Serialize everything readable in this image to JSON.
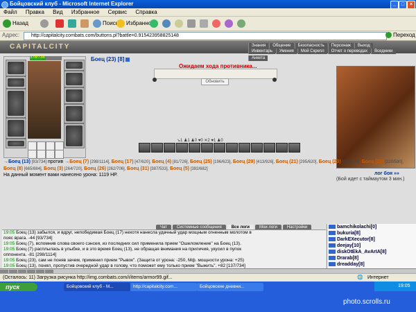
{
  "window": {
    "title": "Бойцовский клуб - Microsoft Internet Explorer",
    "controls": [
      "_",
      "□",
      "×"
    ]
  },
  "menu": [
    "Файл",
    "Правка",
    "Вид",
    "Избранное",
    "Сервис",
    "Справка"
  ],
  "toolbar": {
    "back": "Назад",
    "search": "Поиск",
    "favorites": "Избранное"
  },
  "address": {
    "label": "Адрес:",
    "url": "http://capitalcity.combats.com/buttons.pl?battle=0.915423958825148",
    "go": "Переход"
  },
  "game": {
    "logo": "CAPITALCITY",
    "nav_top": [
      "Знания",
      "Общение",
      "Безопасность",
      "Персонаж",
      "Выход"
    ],
    "nav_bottom": [
      "Инвентарь",
      "Умения",
      "Мой Скрепл",
      "Отчет о переводах",
      "Вседники",
      "Анкета"
    ],
    "player_hp": "378/734",
    "player_hp_fraction": 0.51,
    "opponent_name": "Боец (23) [8]",
    "waiting": "Ожидаем хода противника...",
    "refresh": "Обновить",
    "counters": "↘1 ♟1 ♟0 ♥0 ✕2 ♥1 ♟0",
    "team_line": [
      {
        "t": "→",
        "c": "arr"
      },
      {
        "t": "Боец (13)",
        "c": "me"
      },
      {
        "t": " [93/734] ",
        "c": "hp"
      },
      {
        "t": " против ",
        "c": ""
      },
      {
        "t": "→",
        "c": "arr"
      },
      {
        "t": "Боец (7)",
        "c": "foe"
      },
      {
        "t": " [298/1114], ",
        "c": "hp"
      },
      {
        "t": "Боец (17)",
        "c": "foe"
      },
      {
        "t": " [47/620], ",
        "c": "hp"
      },
      {
        "t": "Боец (4)",
        "c": "foe"
      },
      {
        "t": " [81/726], ",
        "c": "hp"
      },
      {
        "t": "Боец (25)",
        "c": "foe"
      },
      {
        "t": " [196/623], ",
        "c": "hp"
      },
      {
        "t": "Боец (29)",
        "c": "foe"
      },
      {
        "t": " [413/926], ",
        "c": "hp"
      },
      {
        "t": "Боец (21)",
        "c": "foe"
      },
      {
        "t": " [295/620], ",
        "c": "hp"
      },
      {
        "t": "Боец (23)",
        "c": "foe"
      },
      {
        "t": " [378/716], ",
        "c": "hp"
      },
      {
        "t": "Боец (22)",
        "c": "foe"
      },
      {
        "t": " [220/590], ",
        "c": "hp"
      },
      {
        "t": "Боец (8)",
        "c": "foe"
      },
      {
        "t": " [665/884], ",
        "c": "hp"
      },
      {
        "t": "Боец (3)",
        "c": "foe"
      },
      {
        "t": " [264/720], ",
        "c": "hp"
      },
      {
        "t": "Боец (26)",
        "c": "foe"
      },
      {
        "t": " [262/706], ",
        "c": "hp"
      },
      {
        "t": "Боец (31)",
        "c": "foe"
      },
      {
        "t": " [387/533], ",
        "c": "hp"
      },
      {
        "t": "Боец (5)",
        "c": "foe"
      },
      {
        "t": " [392/682]",
        "c": "hp"
      }
    ],
    "damage_text": "На данный момент вами нанесено урона: 1119 HP.",
    "battle_log_link": "лог боя »»",
    "timeout_text": "(Бой идет с таймаутом 3 мин.)"
  },
  "chat": {
    "tabs": [
      "Чат",
      "Системные сообщения",
      "Все логи",
      "Мои логи",
      "Настройки"
    ],
    "active_tab": "Все логи",
    "lines": [
      "19:05 Боец (13) забылся, и вдруг, непобедимая Боец (17) нехотя нанесла удачный удар мощным огненным молотом в",
      "пояс врага. -44 [93/734]",
      "19:05 Боец (7), вспомнив слова своего сэнсея, из последних сил применила прием \"Ошеломление\" на Боец (13).",
      "19:05 Боец (7) расплылась в улыбке, и в это время Боец (13), не обращая внимания на приличия, укусил в пупок",
      "оппонента. -81 [298/1114]",
      "19:05 Боец (23), сам не поняв зачем, применил прием \"Рывок\". (Защита от урона: -250, Мф. мощности урона: +25)",
      "19:05 Боец (13), понял, пропустив очередной удар в голову, что поможет ему только прием \"Выжить\". +82 [137/734]"
    ]
  },
  "users": [
    "bamchikolachi[0]",
    "bukuria[8]",
    "DarkEXecutor[8]",
    "deejay[10]",
    "diskOtEkA_AvArIA[8]",
    "Drarab[8]",
    "dreadday[8]"
  ],
  "statusbar": {
    "text": "(Осталось: 11) Загрузка рисунка http://img.combats.com/i/items/armor99.gif...",
    "zone": "Интернет"
  },
  "taskbar": {
    "start": "пуск",
    "tasks": [
      "Бойцовский клуб - M...",
      "http://capitalcity.com...",
      "Бойцовские дневни..."
    ],
    "clock": "19:05"
  },
  "watermark": "photo.scrolls.ru",
  "colors": {
    "title_bar": "#0a5fd8",
    "player_name": "#003399",
    "opponent_name": "#c25a00",
    "waiting": "#cc0000",
    "hp_bar": "#2aa12a"
  }
}
